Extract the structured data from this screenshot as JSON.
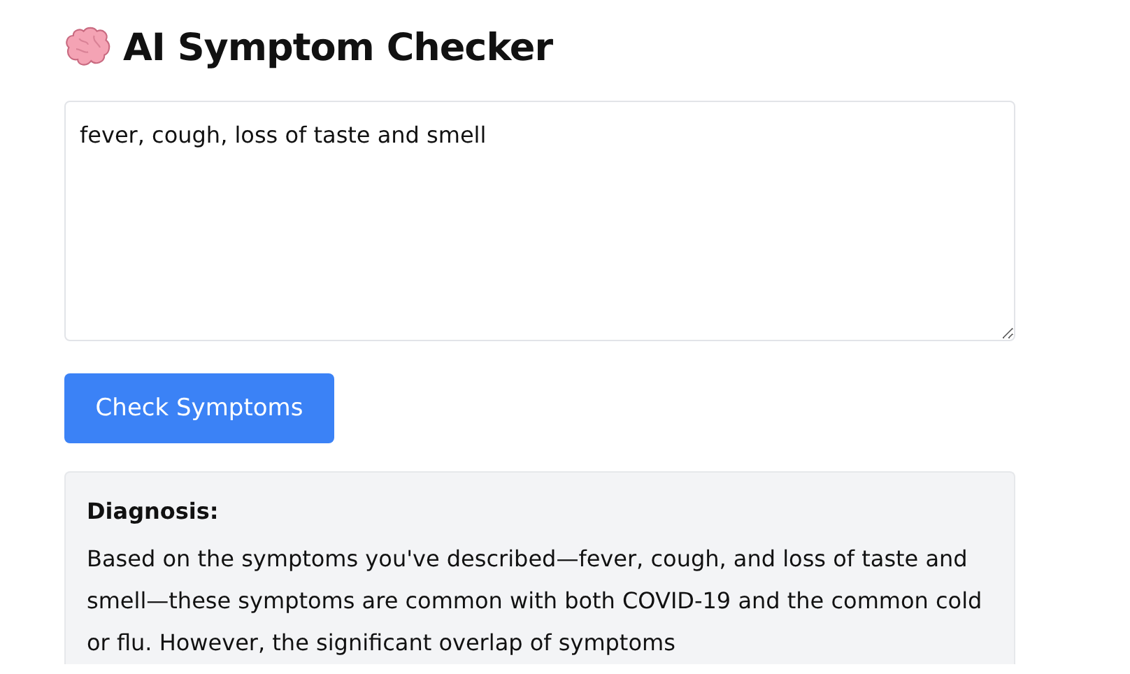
{
  "title": "AI Symptom Checker",
  "symptoms_field": {
    "value": "fever, cough, loss of taste and smell"
  },
  "check_button": "Check Symptoms",
  "result": {
    "heading": "Diagnosis:",
    "text": "Based on the symptoms you've described—fever, cough, and loss of taste and smell—these symptoms are common with both COVID-19 and the common cold or flu. However, the significant overlap of symptoms"
  }
}
